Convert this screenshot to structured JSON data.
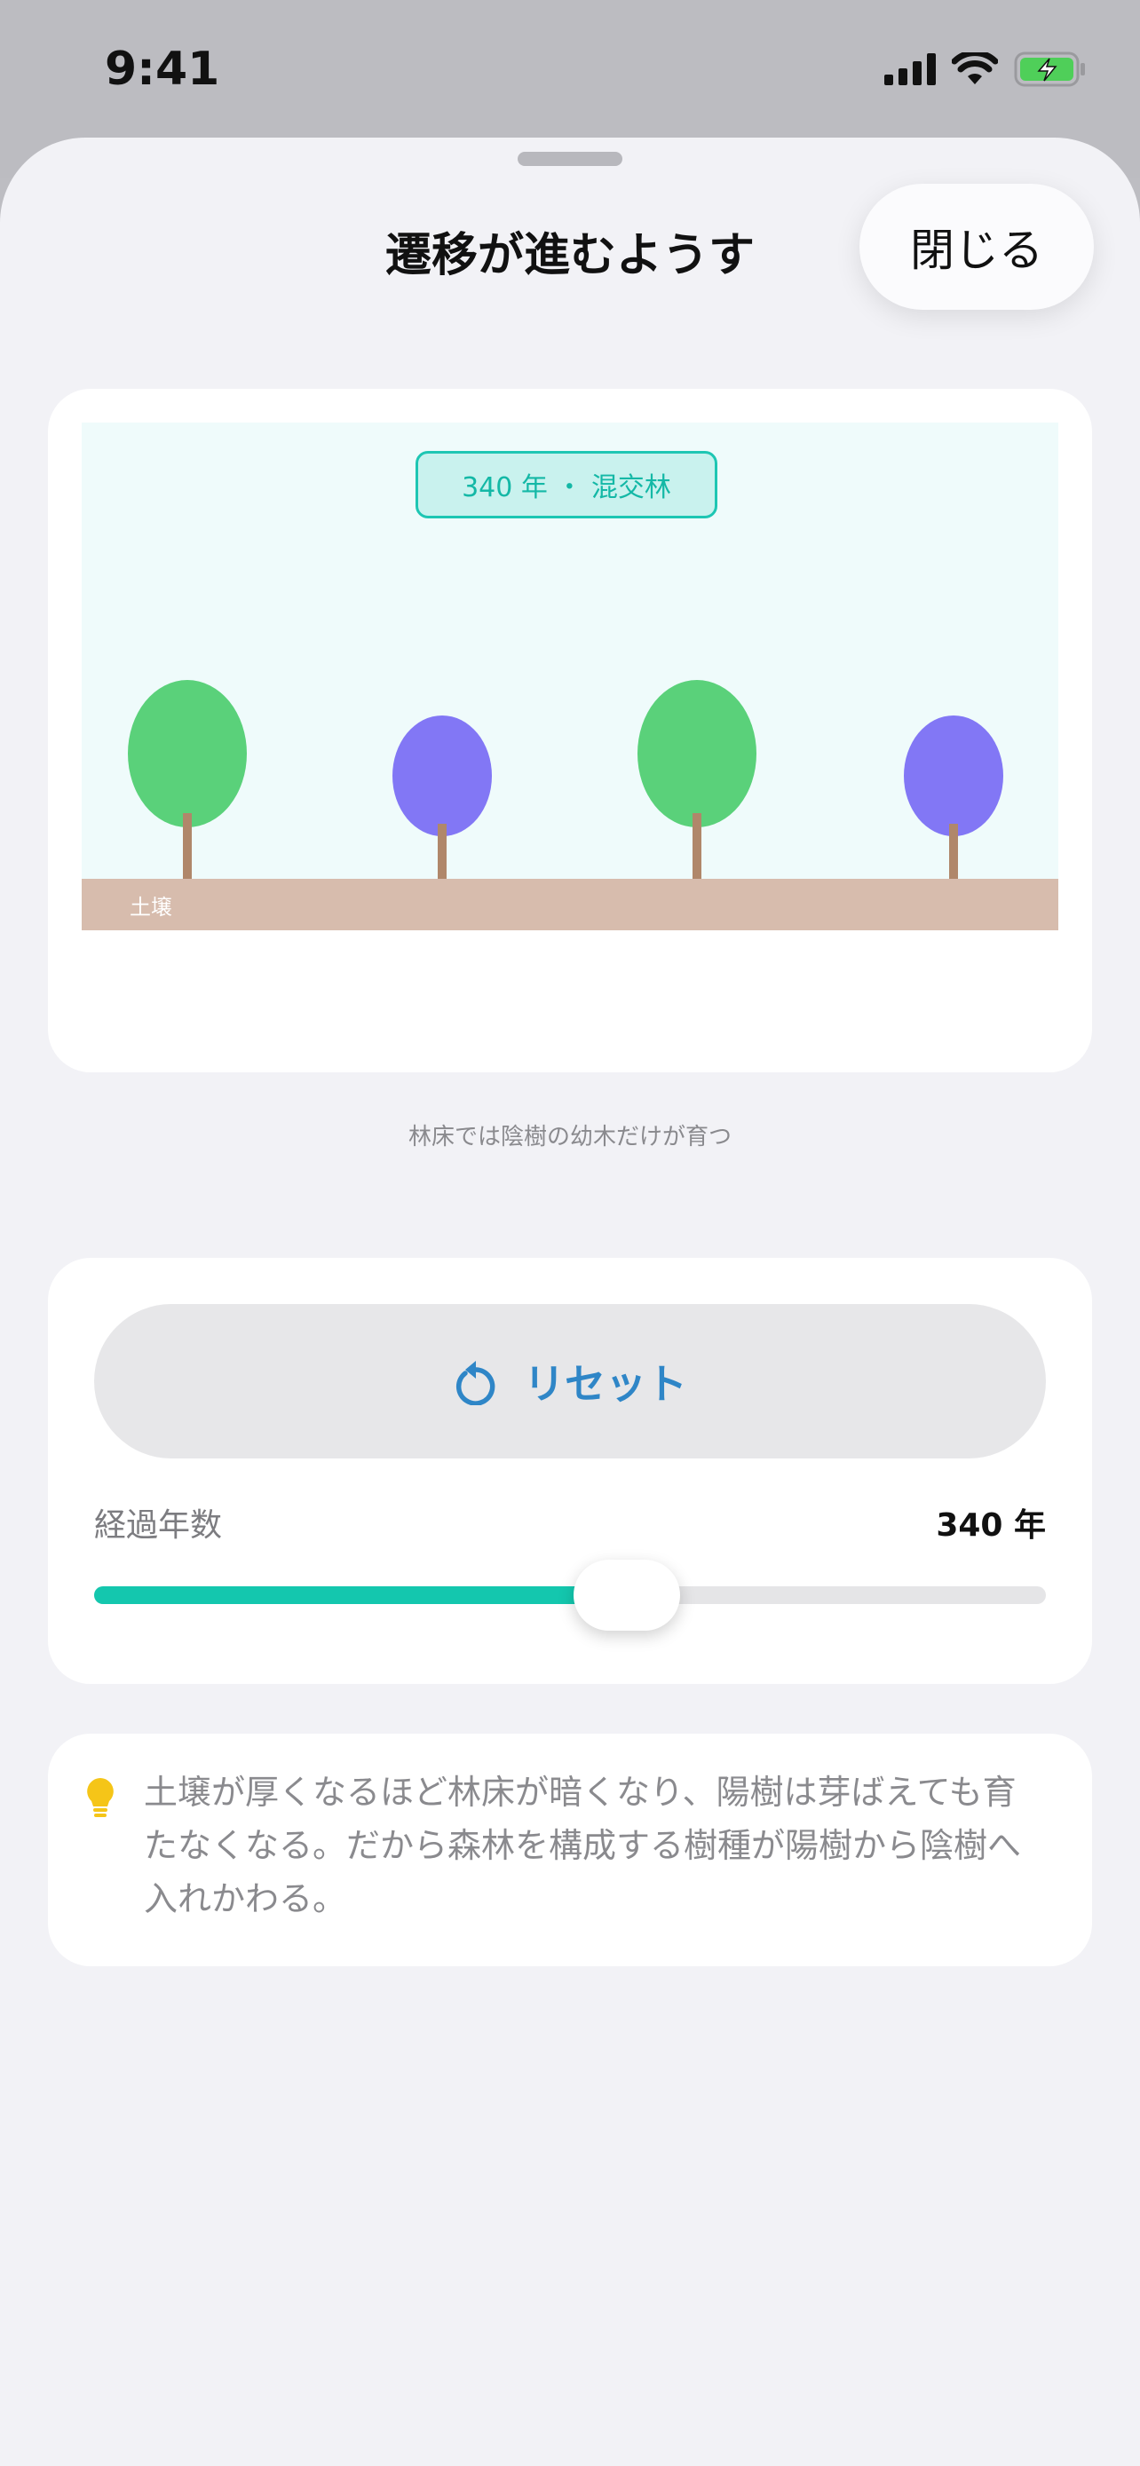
{
  "status_bar": {
    "time": "9:41",
    "icons": [
      "signal-icon",
      "wifi-icon",
      "battery-charging-icon"
    ]
  },
  "sheet": {
    "title": "遷移が進むようす",
    "close_label": "閉じる"
  },
  "illustration": {
    "stage_badge": "340 年 ・ 混交林",
    "soil_label": "土壌",
    "caption": "林床では陰樹の幼木だけが育つ",
    "trees": [
      {
        "kind": "sun-tree",
        "color": "#5ad17a"
      },
      {
        "kind": "shade-tree",
        "color": "#8277f5"
      },
      {
        "kind": "sun-tree",
        "color": "#5ad17a"
      },
      {
        "kind": "shade-tree",
        "color": "#8277f5"
      }
    ],
    "colors": {
      "sky": "#effbfb",
      "soil": "#d7bcad",
      "trunk": "#b0876a",
      "badge_border": "#1ec6b3"
    }
  },
  "controls": {
    "reset_label": "リセット",
    "reset_icon": "rotate-ccw-icon",
    "years_label": "経過年数",
    "years_value": "340 年",
    "slider_fraction": 0.56,
    "accent_color": "#14c7ae",
    "reset_color": "#2f86c7"
  },
  "tip": {
    "icon": "lightbulb-icon",
    "text": "土壌が厚くなるほど林床が暗くなり、陽樹は芽ばえても育たなくなる。だから森林を構成する樹種が陽樹から陰樹へ入れかわる。"
  }
}
